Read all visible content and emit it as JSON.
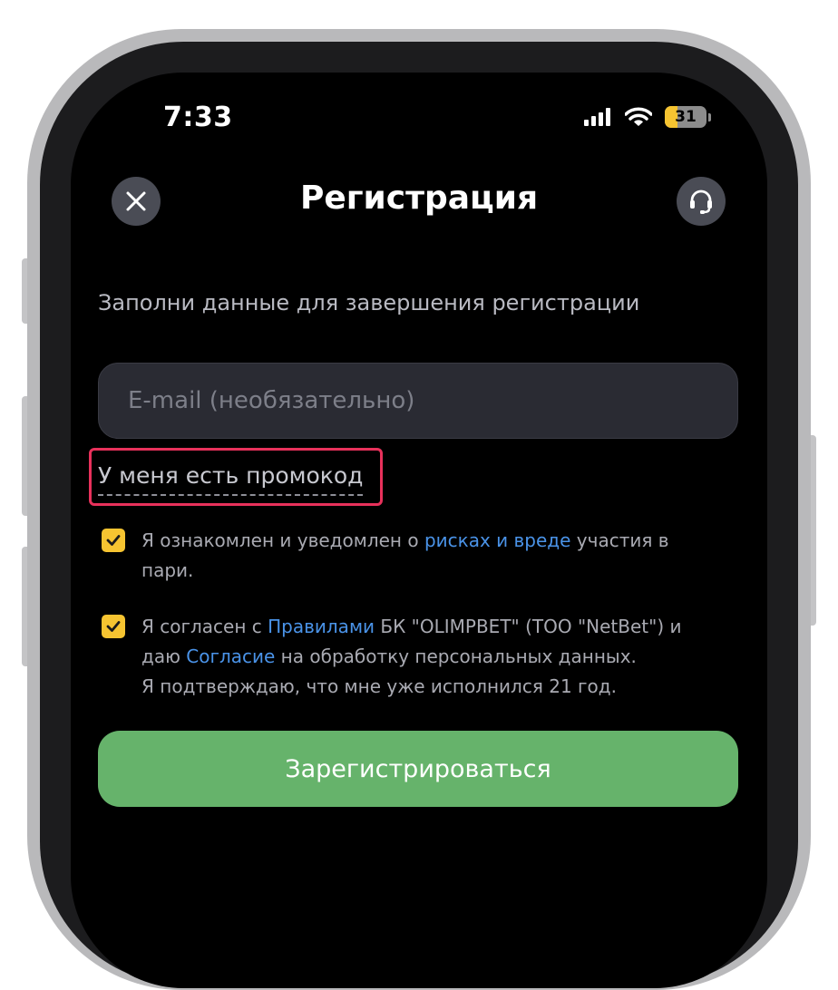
{
  "status_bar": {
    "time": "7:33",
    "battery_level": "31"
  },
  "header": {
    "title": "Регистрация",
    "close_icon": "close-icon",
    "support_icon": "headset-icon"
  },
  "form": {
    "subtitle": "Заполни данные для завершения регистрации",
    "email_placeholder": "E-mail (необязательно)",
    "email_value": "",
    "promo_link": "У меня есть промокод"
  },
  "consent_1": {
    "checked": true,
    "text_before": "Я ознакомлен и уведомлен о ",
    "link": "рисках и вреде",
    "text_after": " участия в пари."
  },
  "consent_2": {
    "checked": true,
    "text_before": "Я согласен с ",
    "link_rules": "Правилами",
    "text_middle": " БК \"OLIMPBET\" (ТОО \"NetBet\") и даю ",
    "link_consent": "Согласие",
    "text_after": " на обработку персональных данных.",
    "age_text": "Я подтверждаю, что мне уже исполнился 21 год."
  },
  "register_button": {
    "label": "Зарегистрироваться"
  },
  "colors": {
    "accent_yellow": "#f6c431",
    "link_blue": "#4a93e8",
    "button_green": "#66b36b",
    "highlight_red": "#e8315b"
  }
}
